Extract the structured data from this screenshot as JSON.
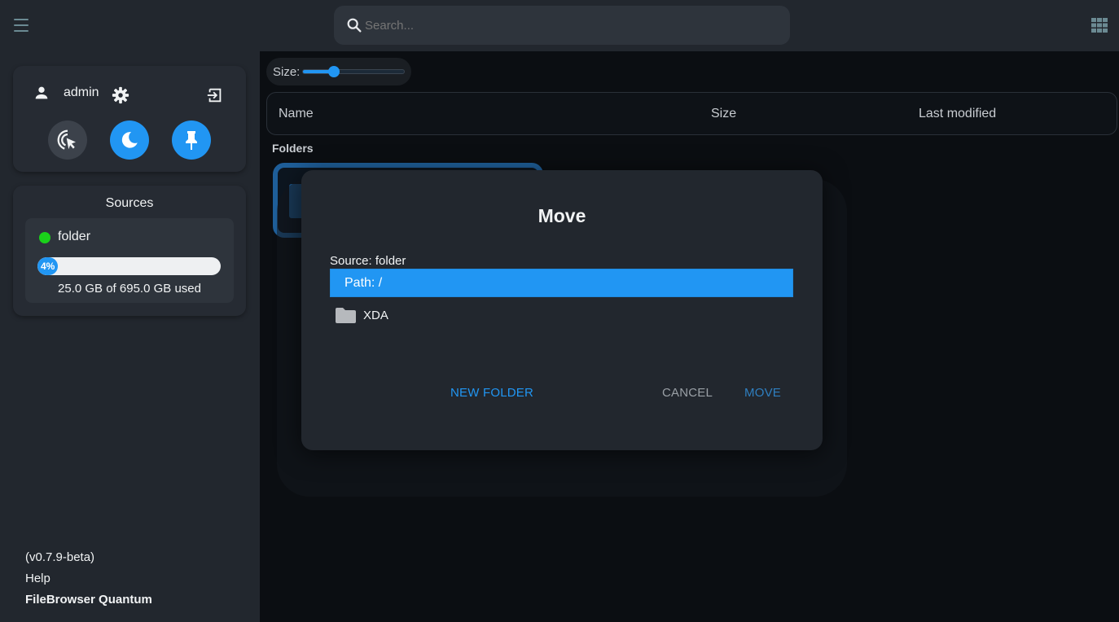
{
  "header": {
    "search_placeholder": "Search...",
    "icons": [
      "menu-icon",
      "search-icon",
      "grid-view-icon"
    ]
  },
  "sidebar": {
    "user": {
      "name": "admin"
    },
    "quick_actions": [
      "pointer-click-icon",
      "dark-mode-icon",
      "pin-icon"
    ],
    "sources_title": "Sources",
    "sources": [
      {
        "name": "folder",
        "status_color": "#1ad11a",
        "usage_percent": 4,
        "usage_label": "4%",
        "usage_text": "25.0 GB of 695.0 GB used"
      }
    ],
    "footer": {
      "version": "(v0.7.9-beta)",
      "help": "Help",
      "brand": "FileBrowser Quantum"
    }
  },
  "main": {
    "size_label": "Size:",
    "size_slider_fraction": 0.3,
    "columns": {
      "name": "Name",
      "size": "Size",
      "modified": "Last modified"
    },
    "folders_label": "Folders"
  },
  "modal": {
    "title": "Move",
    "source": "Source: folder",
    "path": "Path: /",
    "items": [
      {
        "name": "XDA",
        "icon": "folder-icon"
      }
    ],
    "buttons": {
      "new_folder": "NEW FOLDER",
      "cancel": "CANCEL",
      "move": "MOVE"
    }
  },
  "colors": {
    "accent": "#2196f3",
    "sidebar_bg": "#22272e",
    "main_bg": "#0b0e12"
  }
}
